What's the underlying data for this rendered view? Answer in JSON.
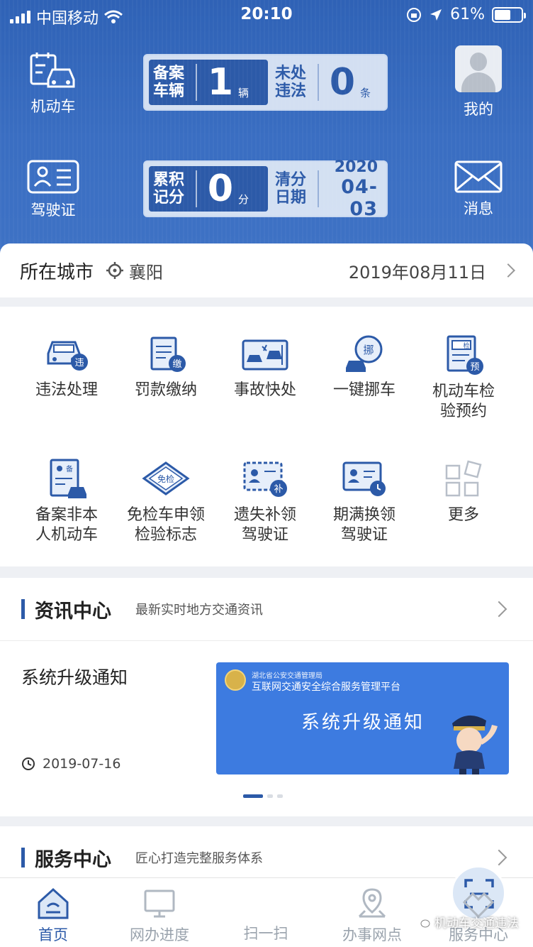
{
  "status_bar": {
    "carrier": "中国移动",
    "time": "20:10",
    "battery": "61%"
  },
  "header": {
    "vehicle_label": "机动车",
    "license_label": "驾驶证",
    "profile_label": "我的",
    "message_label": "消息",
    "registered": {
      "label": "备案车辆",
      "value": "1",
      "unit": "辆"
    },
    "violations": {
      "label": "未处违法",
      "value": "0",
      "unit": "条"
    },
    "points": {
      "label": "累积记分",
      "value": "0",
      "unit": "分"
    },
    "clear_date": {
      "label": "清分日期",
      "year": "2020",
      "month_day": "04-03"
    }
  },
  "city_bar": {
    "label": "所在城市",
    "city": "襄阳",
    "date": "2019年08月11日"
  },
  "services": [
    {
      "line1": "违法处理",
      "line2": ""
    },
    {
      "line1": "罚款缴纳",
      "line2": ""
    },
    {
      "line1": "事故快处",
      "line2": ""
    },
    {
      "line1": "一键挪车",
      "line2": ""
    },
    {
      "line1": "机动车检",
      "line2": "验预约"
    },
    {
      "line1": "备案非本",
      "line2": "人机动车"
    },
    {
      "line1": "免检车申领",
      "line2": "检验标志"
    },
    {
      "line1": "遗失补领",
      "line2": "驾驶证"
    },
    {
      "line1": "期满换领",
      "line2": "驾驶证"
    },
    {
      "line1": "更多",
      "line2": ""
    }
  ],
  "icon_badges": {
    "violation": "违",
    "fine": "缴",
    "move": "挪",
    "inspect": "检",
    "book": "预",
    "record": "备",
    "exempt": "免检",
    "reissue": "补"
  },
  "news_section": {
    "title": "资讯中心",
    "subtitle": "最新实时地方交通资讯",
    "item_title": "系统升级通知",
    "item_date": "2019-07-16",
    "banner_org": "湖北省公安交通管理局",
    "banner_platform": "互联网交通安全综合服务管理平台",
    "banner_text": "系统升级通知"
  },
  "service_section": {
    "title": "服务中心",
    "subtitle": "匠心打造完整服务体系"
  },
  "tabs": [
    {
      "label": "首页"
    },
    {
      "label": "网办进度"
    },
    {
      "label": "扫一扫"
    },
    {
      "label": "办事网点"
    },
    {
      "label": "服务中心"
    }
  ],
  "watermark": "机动车交通违法",
  "colors": {
    "primary": "#2c5aa8",
    "header_bg": "#3a6ec2",
    "banner_bg": "#3d7be0"
  }
}
